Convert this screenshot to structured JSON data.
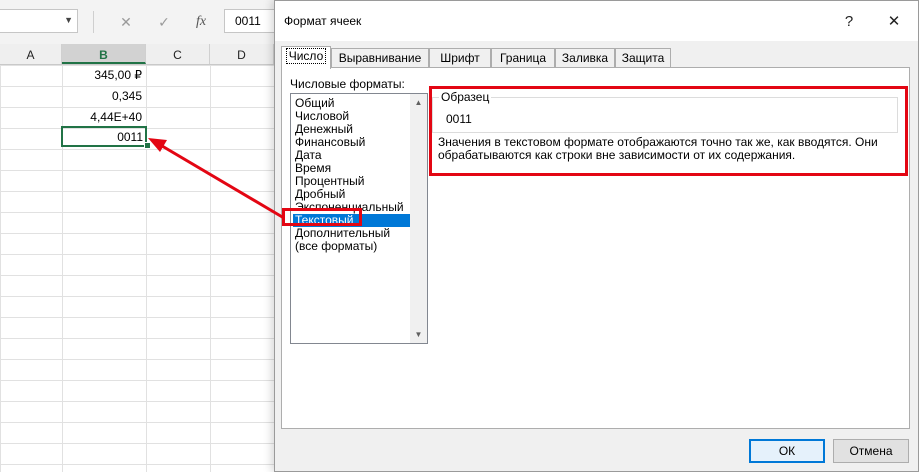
{
  "excel": {
    "formula_bar": {
      "cancel_icon": "✕",
      "enter_icon": "✓",
      "function_icon": "fx",
      "value": "0011"
    },
    "columns": [
      "A",
      "B",
      "C",
      "D"
    ],
    "cells": [
      "345,00 ₽",
      "0,345",
      "4,44E+40",
      "0011"
    ]
  },
  "dialog": {
    "title": "Формат ячеек",
    "help_glyph": "?",
    "close_glyph": "✕",
    "tabs": [
      "Число",
      "Выравнивание",
      "Шрифт",
      "Граница",
      "Заливка",
      "Защита"
    ],
    "active_tab": "Число",
    "formats_label": "Числовые форматы:",
    "formats": [
      "Общий",
      "Числовой",
      "Денежный",
      "Финансовый",
      "Дата",
      "Время",
      "Процентный",
      "Дробный",
      "Экспоненциальный",
      "Текстовый",
      "Дополнительный",
      "(все форматы)"
    ],
    "selected_format": "Текстовый",
    "sample_label": "Образец",
    "sample_value": "0011",
    "description_line1": "Значения в текстовом формате отображаются точно так же, как вводятся. Они",
    "description_line2": "обрабатываются как строки вне зависимости от их содержания.",
    "ok_label": "ОК",
    "cancel_label": "Отмена"
  },
  "colors": {
    "excel_green": "#217346",
    "selection_blue": "#0078d7",
    "annotation_red": "#e30613"
  }
}
